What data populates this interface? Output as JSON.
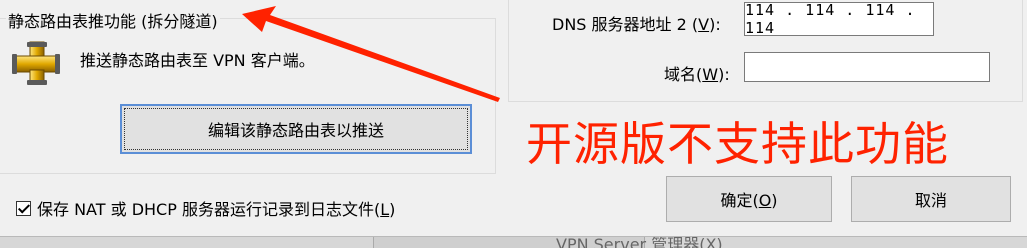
{
  "left_group": {
    "title": "静态路由表推功能 (拆分隧道)",
    "description": "推送静态路由表至 VPN 客户端。",
    "edit_button": "编辑该静态路由表以推送"
  },
  "dns": {
    "dns2_label": "DNS 服务器地址 2 (",
    "dns2_key": "V",
    "dns2_suffix": "):",
    "dns2_value": "114 . 114 . 114 . 114",
    "domain_label": "域名(",
    "domain_key": "W",
    "domain_suffix": "):",
    "domain_value": ""
  },
  "annotation": {
    "text": "开源版不支持此功能",
    "color": "#ff2200"
  },
  "log_checkbox": {
    "label": "保存 NAT 或 DHCP 服务器运行记录到日志文件(",
    "key": "L",
    "suffix": ")",
    "checked": true
  },
  "buttons": {
    "ok": "确定(",
    "ok_key": "O",
    "ok_suffix": ")",
    "cancel": "取消"
  },
  "background_window": {
    "title_fragment": "VPN Server 管理器(X)"
  },
  "icons": {
    "pipe": "pipe-fitting-icon",
    "checkbox": "checkbox-checked-icon"
  }
}
